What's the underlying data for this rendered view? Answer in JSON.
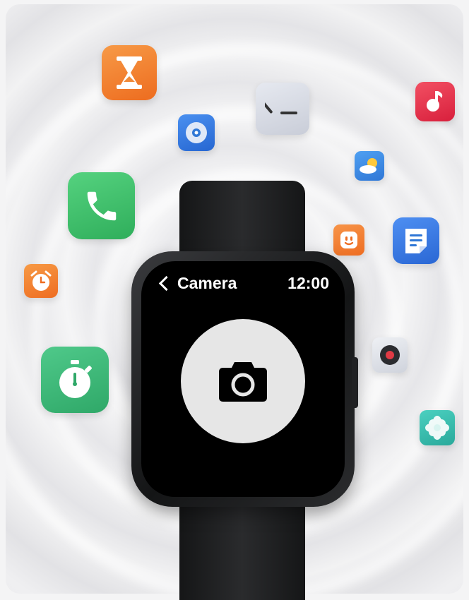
{
  "screen": {
    "title": "Camera",
    "time": "12:00"
  },
  "icons": [
    "hourglass-icon",
    "clock-icon",
    "music-icon",
    "compact-disc-icon",
    "weather-icon",
    "phone-icon",
    "face-icon",
    "notes-icon",
    "alarm-icon",
    "stopwatch-icon",
    "record-icon",
    "flower-icon",
    "camera-icon"
  ],
  "colors": {
    "watch_body": "#1e1f21",
    "screen": "#000000",
    "shutter": "#e6e6e6",
    "orange": "#f07a2b",
    "green": "#3cbf6a",
    "blue": "#2f77d6",
    "red": "#e8314b",
    "teal": "#3bb9ab"
  }
}
